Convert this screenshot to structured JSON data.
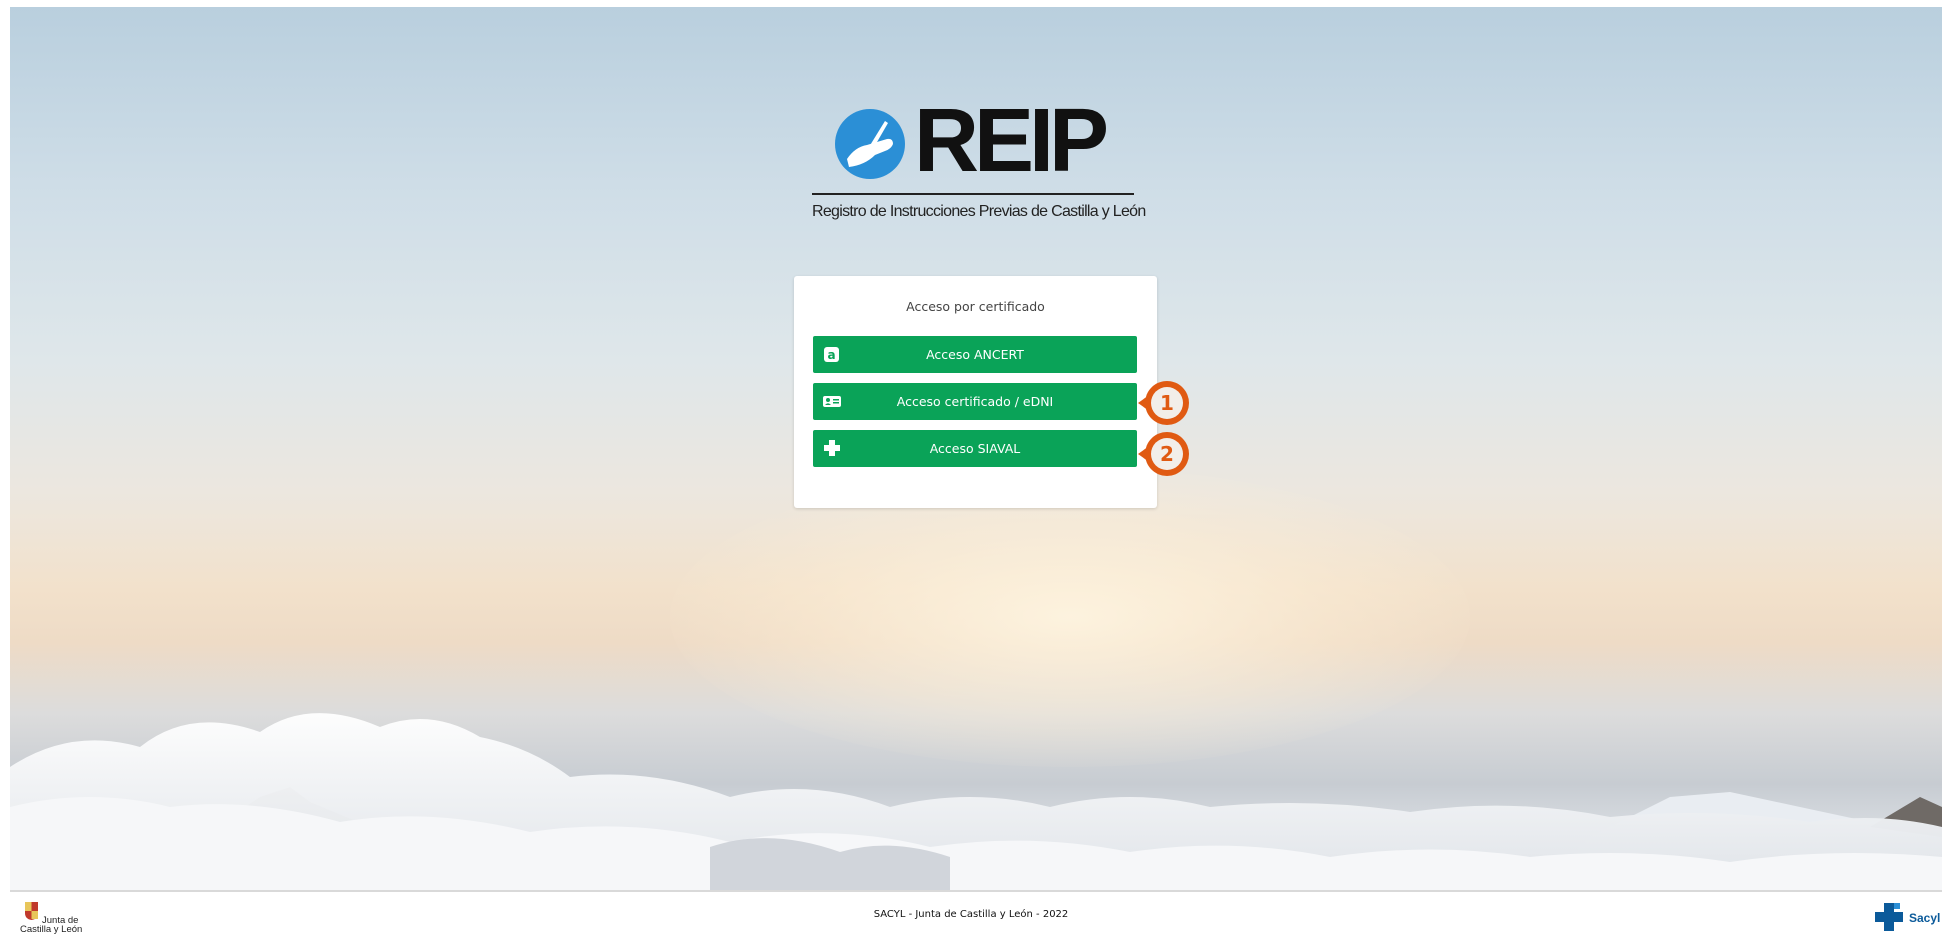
{
  "logo": {
    "wordmark": "REIP",
    "tagline": "Registro de Instrucciones Previas de Castilla y León",
    "mark_color": "#2b8fd6"
  },
  "login_card": {
    "title": "Acceso por certificado",
    "buttons": [
      {
        "label": "Acceso ANCERT",
        "icon": "ancert-a-icon"
      },
      {
        "label": "Acceso certificado / eDNI",
        "icon": "id-card-icon"
      },
      {
        "label": "Acceso SIAVAL",
        "icon": "siaval-cross-icon"
      }
    ],
    "button_color": "#0aa358"
  },
  "annotations": [
    {
      "number": "1",
      "target": "Acceso certificado / eDNI"
    },
    {
      "number": "2",
      "target": "Acceso SIAVAL"
    }
  ],
  "annotation_color": "#e05a12",
  "footer": {
    "text": "SACYL - Junta de Castilla y León - 2022",
    "left_logo": {
      "line1": "Junta de",
      "line2": "Castilla y León"
    },
    "right_logo": {
      "text": "Sacyl"
    }
  }
}
